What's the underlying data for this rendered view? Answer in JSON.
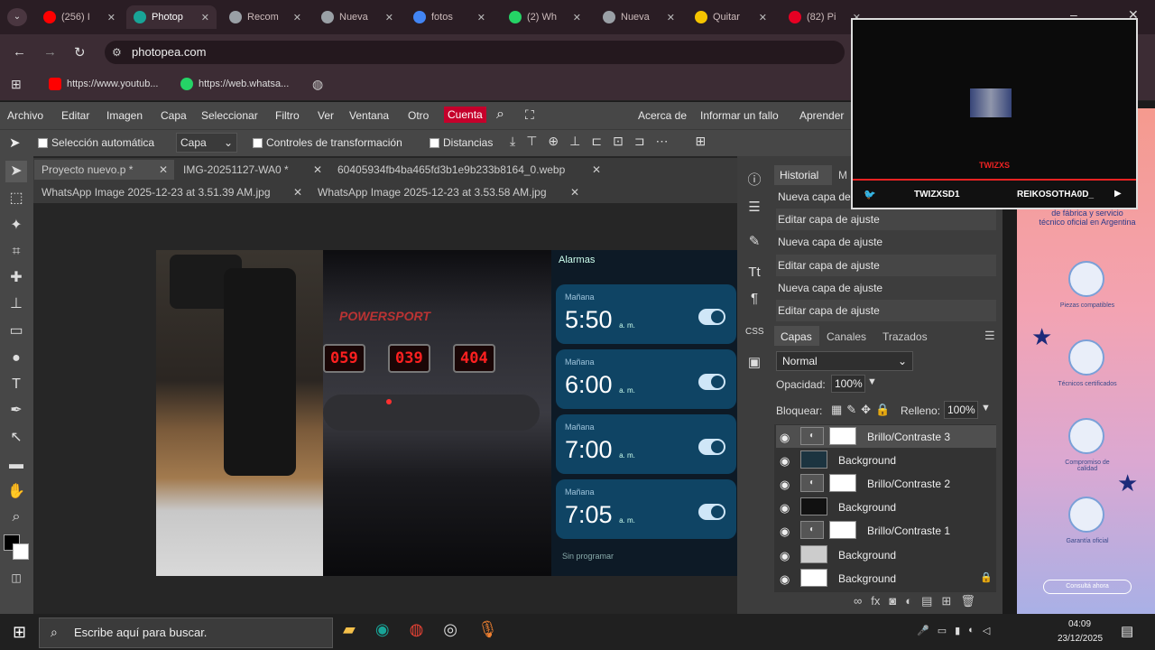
{
  "browser": {
    "tabs": [
      {
        "label": "(256) I",
        "color": "#ff0000"
      },
      {
        "label": "Photop",
        "color": "#18a497"
      },
      {
        "label": "Recom",
        "color": "#9aa0a6"
      },
      {
        "label": "Nueva",
        "color": "#9aa0a6"
      },
      {
        "label": "fotos",
        "color": "#4285f4"
      },
      {
        "label": "(2) Wh",
        "color": "#25d366"
      },
      {
        "label": "Nueva",
        "color": "#9aa0a6"
      },
      {
        "label": "Quitar",
        "color": "#f5c400"
      },
      {
        "label": "(82) Pi",
        "color": "#e60023"
      }
    ],
    "url": "photopea.com",
    "bookmarks": [
      {
        "label": "https://www.youtub...",
        "color": "#ff0000"
      },
      {
        "label": "https://web.whatsa...",
        "color": "#25d366"
      }
    ]
  },
  "menu": {
    "items": [
      "Archivo",
      "Editar",
      "Imagen",
      "Capa",
      "Seleccionar",
      "Filtro",
      "Ver",
      "Ventana",
      "Otro"
    ],
    "account": "Cuenta",
    "right": [
      "Acerca de",
      "Informar un fallo",
      "Aprender"
    ]
  },
  "options": {
    "auto_select": "Selección automática",
    "mode": "Capa",
    "transform_controls": "Controles de transformación",
    "distances": "Distancias"
  },
  "doc_tabs": [
    {
      "label": "Proyecto nuevo.p *"
    },
    {
      "label": "IMG-20251127-WA0 *"
    },
    {
      "label": "60405934fb4ba465fd3b1e9b233b8164_0.webp"
    },
    {
      "label": "WhatsApp Image 2025-12-23 at 3.51.39 AM.jpg"
    },
    {
      "label": "WhatsApp Image 2025-12-23 at 3.53.58 AM.jpg"
    }
  ],
  "canvas": {
    "machine_brand": "POWERSPORT",
    "displays": [
      "059",
      "039",
      "404"
    ],
    "phone_header": "Alarmas",
    "alarms": [
      {
        "label": "Mañana",
        "time": "5:50",
        "ampm": "a. m."
      },
      {
        "label": "Mañana",
        "time": "6:00",
        "ampm": "a. m."
      },
      {
        "label": "Mañana",
        "time": "7:00",
        "ampm": "a. m."
      },
      {
        "label": "Mañana",
        "time": "7:05",
        "ampm": "a. m."
      }
    ],
    "unscheduled": "Sin programar"
  },
  "history": {
    "tabs": [
      "Historial",
      "M"
    ],
    "items": [
      "Nueva capa de ajuste",
      "Editar capa de ajuste",
      "Nueva capa de ajuste",
      "Editar capa de ajuste",
      "Nueva capa de ajuste",
      "Editar capa de ajuste"
    ]
  },
  "layers_panel": {
    "tabs": [
      "Capas",
      "Canales",
      "Trazados"
    ],
    "blend_mode": "Normal",
    "opacity_label": "Opacidad:",
    "opacity": "100%",
    "lock_label": "Bloquear:",
    "fill_label": "Relleno:",
    "fill": "100%",
    "layers": [
      {
        "name": "Brillo/Contraste 3",
        "type": "adjustment"
      },
      {
        "name": "Background",
        "type": "image"
      },
      {
        "name": "Brillo/Contraste 2",
        "type": "adjustment"
      },
      {
        "name": "Background",
        "type": "image"
      },
      {
        "name": "Brillo/Contraste 1",
        "type": "adjustment"
      },
      {
        "name": "Background",
        "type": "image"
      },
      {
        "name": "Background",
        "type": "image"
      }
    ]
  },
  "stream_overlay": {
    "name": "TWIZXS",
    "handles": [
      "TWIZXSD1",
      "REIKOSOTHA0D_"
    ]
  },
  "ad": {
    "heading": "de fábrica y servicio técnico oficial en Argentina",
    "features": [
      "Piezas compatibles",
      "Técnicos certificados",
      "Compromiso de calidad",
      "Garantía oficial"
    ],
    "cta": "Consultá ahora"
  },
  "taskbar": {
    "search_placeholder": "Escribe aquí para buscar.",
    "time": "04:09",
    "date": "23/12/2025"
  }
}
